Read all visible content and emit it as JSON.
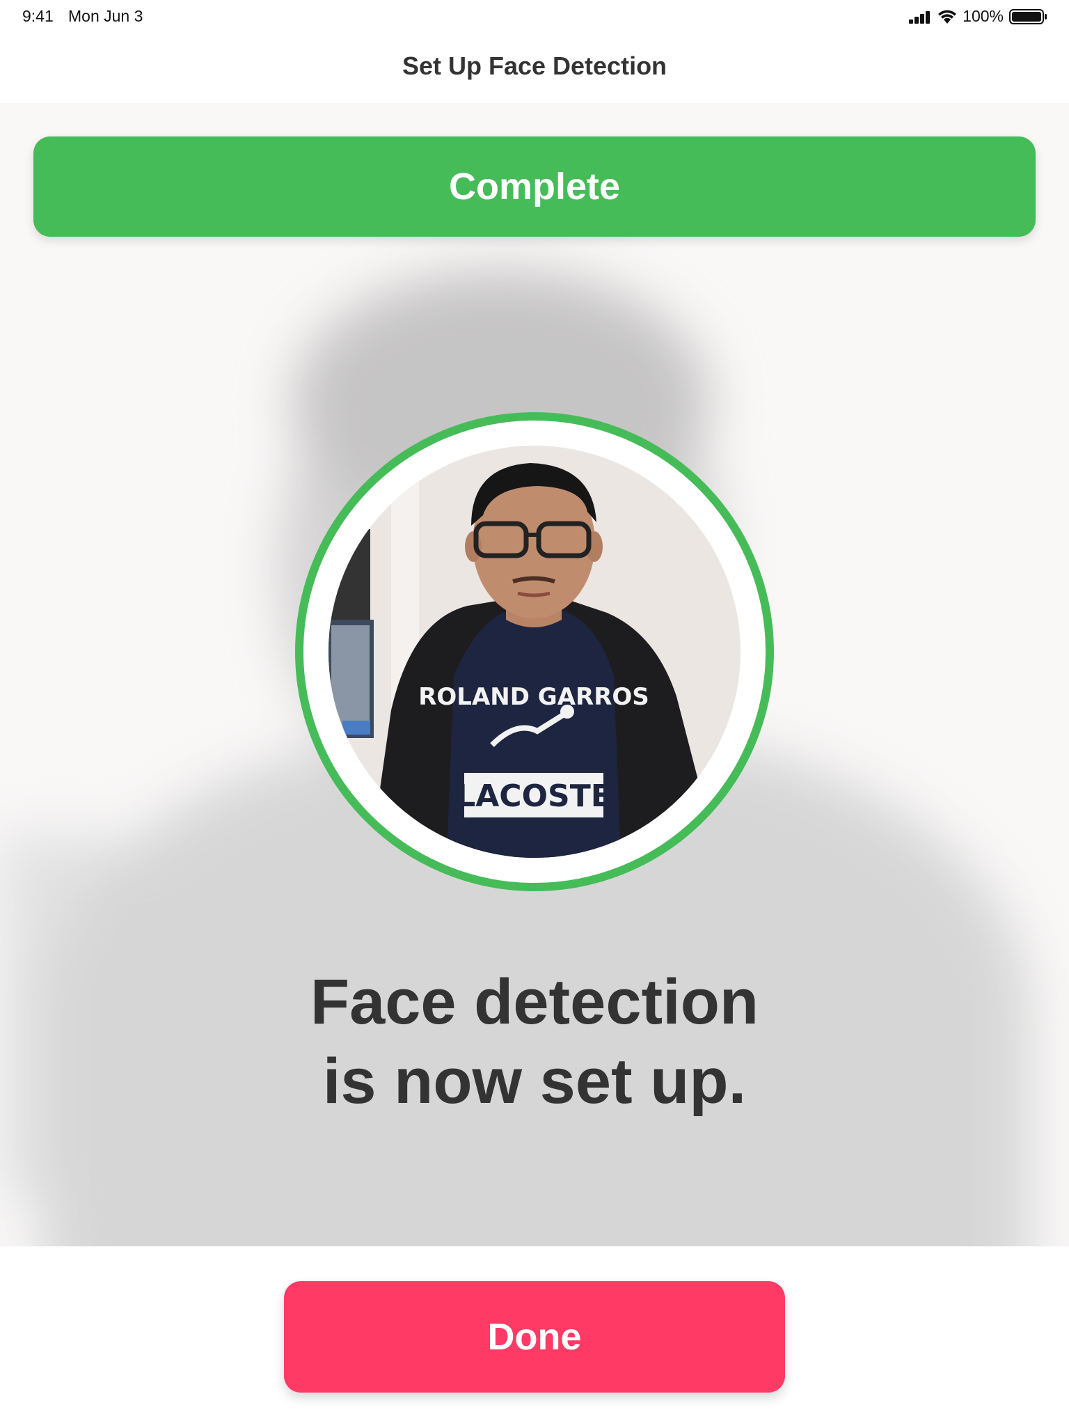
{
  "status_bar": {
    "time": "9:41",
    "date": "Mon Jun 3",
    "battery": "100%",
    "signal_icon": "cellular-signal-icon",
    "wifi_icon": "wifi-icon",
    "battery_icon": "battery-icon"
  },
  "nav": {
    "title": "Set Up Face Detection"
  },
  "banner": {
    "label": "Complete",
    "color": "#46bc59"
  },
  "portrait": {
    "ring_color": "#46bc59",
    "shirt_lines": [
      "ROLAND GARROS",
      "LACOSTE"
    ]
  },
  "message": {
    "line1": "Face detection",
    "line2": "is now set up."
  },
  "footer": {
    "done_label": "Done",
    "done_color": "#ff3a64"
  }
}
